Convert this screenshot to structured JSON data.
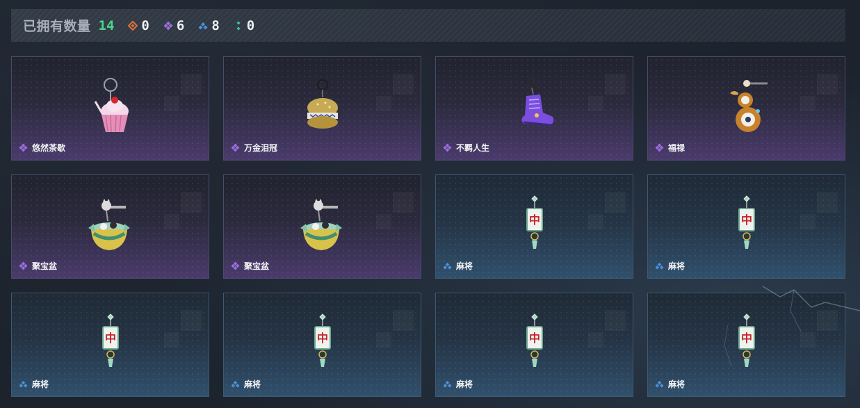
{
  "header": {
    "owned_label": "已拥有数量",
    "owned_count": "14",
    "stats": [
      {
        "icon": "orange-gem-icon",
        "color": "#e0743a",
        "value": "0"
      },
      {
        "icon": "purple-gem-icon",
        "color": "#9a6cdc",
        "value": "6"
      },
      {
        "icon": "blue-gem-icon",
        "color": "#4d8fd8",
        "value": "8"
      },
      {
        "icon": "green-gem-icon",
        "color": "#3fc79b",
        "value": "0"
      }
    ]
  },
  "items": [
    {
      "name": "悠然茶歇",
      "rarity": "epic",
      "art": "cupcake-charm-icon"
    },
    {
      "name": "万金泪冠",
      "rarity": "epic",
      "art": "golden-burger-charm-icon"
    },
    {
      "name": "不羁人生",
      "rarity": "epic",
      "art": "purple-sneaker-charm-icon"
    },
    {
      "name": "福禄",
      "rarity": "epic",
      "art": "gourd-charm-icon"
    },
    {
      "name": "聚宝盆",
      "rarity": "epic",
      "art": "treasure-bowl-charm-icon"
    },
    {
      "name": "聚宝盆",
      "rarity": "epic",
      "art": "treasure-bowl-charm-icon"
    },
    {
      "name": "麻将",
      "rarity": "rare",
      "art": "mahjong-tile-charm-icon"
    },
    {
      "name": "麻将",
      "rarity": "rare",
      "art": "mahjong-tile-charm-icon"
    },
    {
      "name": "麻将",
      "rarity": "rare",
      "art": "mahjong-tile-charm-icon"
    },
    {
      "name": "麻将",
      "rarity": "rare",
      "art": "mahjong-tile-charm-icon"
    },
    {
      "name": "麻将",
      "rarity": "rare",
      "art": "mahjong-tile-charm-icon"
    },
    {
      "name": "麻将",
      "rarity": "rare",
      "art": "mahjong-tile-charm-icon"
    }
  ],
  "mahjong_tile_glyph": "中",
  "colors": {
    "epic": "#9a6cdc",
    "rare": "#4d8fd8"
  }
}
